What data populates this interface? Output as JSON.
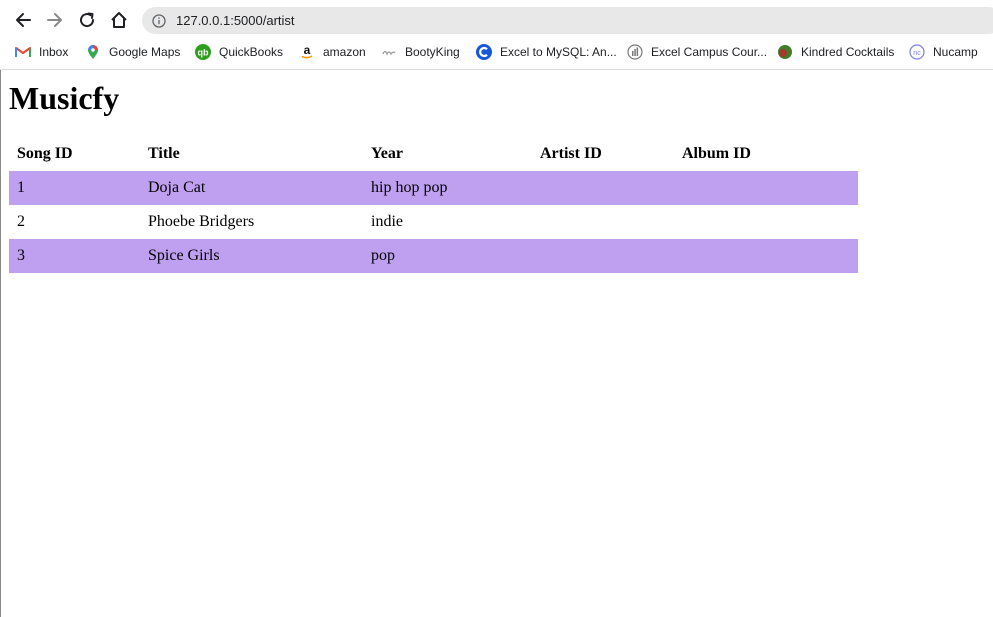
{
  "browser": {
    "url": "127.0.0.1:5000/artist",
    "bookmarks": [
      {
        "label": "Inbox",
        "icon": "gmail-icon"
      },
      {
        "label": "Google Maps",
        "icon": "google-maps-icon"
      },
      {
        "label": "QuickBooks",
        "icon": "quickbooks-icon"
      },
      {
        "label": "amazon",
        "icon": "amazon-icon"
      },
      {
        "label": "BootyKing",
        "icon": "bootyking-icon"
      },
      {
        "label": "Excel to MySQL: An...",
        "icon": "excel-mysql-icon"
      },
      {
        "label": "Excel Campus Cour...",
        "icon": "excel-campus-icon"
      },
      {
        "label": "Kindred Cocktails",
        "icon": "kindred-cocktails-icon"
      },
      {
        "label": "Nucamp",
        "icon": "nucamp-icon"
      }
    ]
  },
  "page": {
    "title": "Musicfy",
    "table": {
      "headers": [
        "Song ID",
        "Title",
        "Year",
        "Artist ID",
        "Album ID"
      ],
      "rows": [
        [
          "1",
          "Doja Cat",
          "hip hop pop",
          "",
          ""
        ],
        [
          "2",
          "Phoebe Bridgers",
          "indie",
          "",
          ""
        ],
        [
          "3",
          "Spice Girls",
          "pop",
          "",
          ""
        ]
      ]
    }
  },
  "colors": {
    "row_highlight": "#bf9ff0",
    "omnibox_bg": "#e8e8e8"
  }
}
